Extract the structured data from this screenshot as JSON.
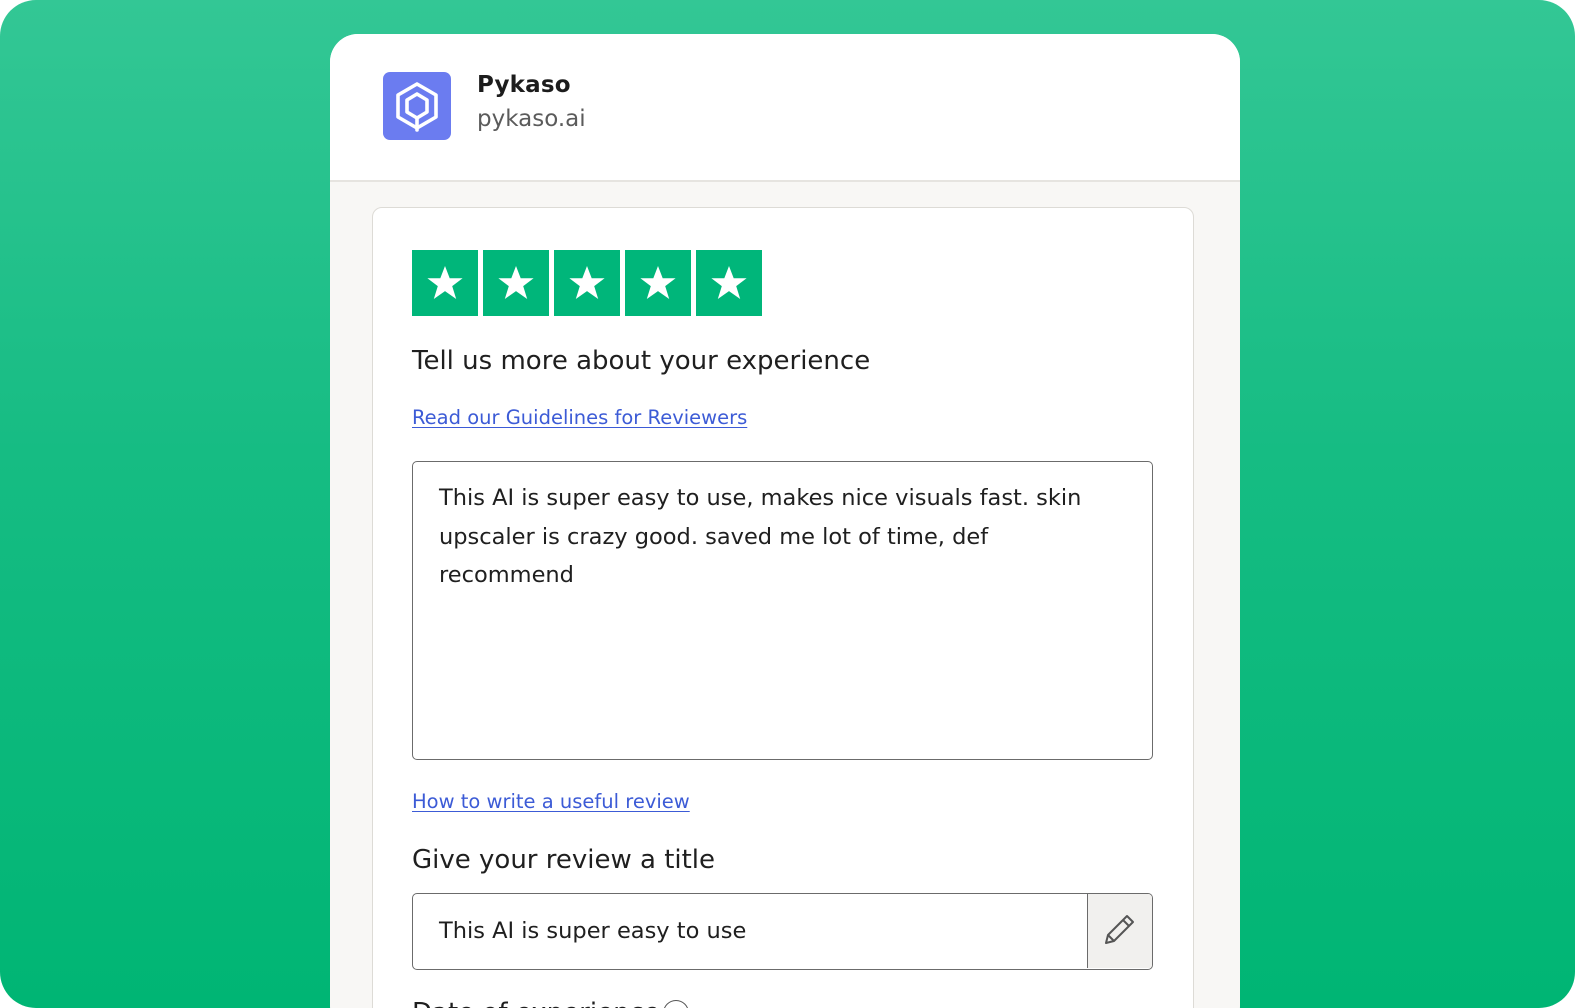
{
  "company": {
    "name": "Pykaso",
    "domain": "pykaso.ai",
    "logo_icon": "pykaso-hexagon-logo-icon",
    "logo_color": "#6b7cf0"
  },
  "rating": {
    "stars_selected": 5,
    "stars_total": 5,
    "star_color": "#00b67a",
    "star_icon": "star-icon"
  },
  "form": {
    "prompt": "Tell us more about your experience",
    "guidelines_link": "Read our Guidelines for Reviewers",
    "review_body": "This AI is super easy to use, makes nice visuals fast. skin upscaler is crazy good. saved me lot of time, def recommend",
    "howto_link": "How to write a useful review",
    "title_heading": "Give your review a title",
    "title_value": "This AI is super easy to use",
    "edit_icon": "pencil-icon",
    "next_section_label": "Date of experience"
  },
  "colors": {
    "background": "#00b574",
    "link": "#3c5bd6"
  }
}
